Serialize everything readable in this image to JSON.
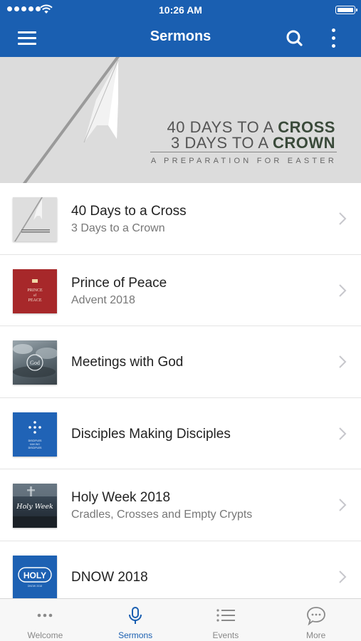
{
  "status_bar": {
    "time": "10:26 AM"
  },
  "nav": {
    "title": "Sermons"
  },
  "banner": {
    "line1_light": "40 DAYS TO A ",
    "line1_bold": "CROSS",
    "line2_light": "3 DAYS TO A ",
    "line2_bold": "CROWN",
    "subtitle": "A PREPARATION FOR EASTER"
  },
  "sermons": [
    {
      "title": "40 Days to a Cross",
      "subtitle": "3 Days to a Crown",
      "thumb_icon": "cross-series-thumbnail"
    },
    {
      "title": "Prince of Peace",
      "subtitle": "Advent 2018",
      "thumb_icon": "prince-of-peace-thumbnail",
      "thumb_text_1": "PRINCE",
      "thumb_text_2": "of",
      "thumb_text_3": "PEACE"
    },
    {
      "title": "Meetings with God",
      "subtitle": "",
      "thumb_icon": "meetings-with-god-thumbnail",
      "thumb_text": "God"
    },
    {
      "title": "Disciples Making Disciples",
      "subtitle": "",
      "thumb_icon": "disciples-thumbnail",
      "thumb_text_1": "DISCIPLES",
      "thumb_text_2": "MAKING",
      "thumb_text_3": "DISCIPLES"
    },
    {
      "title": "Holy Week 2018",
      "subtitle": "Cradles, Crosses and Empty Crypts",
      "thumb_icon": "holy-week-thumbnail",
      "thumb_text": "Holy Week"
    },
    {
      "title": "DNOW 2018",
      "subtitle": "",
      "thumb_icon": "dnow-thumbnail",
      "thumb_text": "HOLY",
      "thumb_subtext": "DNOW 2018"
    }
  ],
  "tabs": [
    {
      "label": "Welcome",
      "icon": "ellipsis-icon",
      "active": false
    },
    {
      "label": "Sermons",
      "icon": "microphone-icon",
      "active": true
    },
    {
      "label": "Events",
      "icon": "list-icon",
      "active": false
    },
    {
      "label": "More",
      "icon": "chat-bubble-icon",
      "active": false
    }
  ],
  "colors": {
    "primary": "#1a5fb1",
    "banner_bg": "#dcdcdc",
    "tab_inactive": "#888888",
    "tab_active": "#1a5fb1"
  }
}
